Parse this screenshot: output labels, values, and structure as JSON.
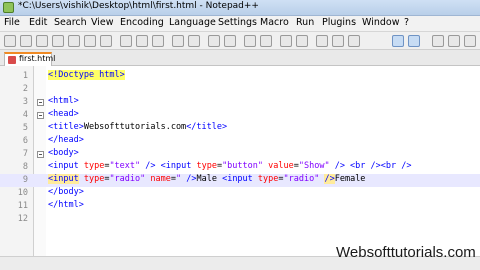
{
  "window": {
    "title": "*C:\\Users\\vishik\\Desktop\\html\\first.html - Notepad++"
  },
  "menu": [
    "File",
    "Edit",
    "Search",
    "View",
    "Encoding",
    "Language",
    "Settings",
    "Macro",
    "Run",
    "Plugins",
    "Window",
    "?"
  ],
  "toolbar": {
    "icons": [
      "new-file-icon",
      "open-file-icon",
      "save-icon",
      "save-all-icon",
      "close-icon",
      "close-all-icon",
      "print-icon",
      "cut-icon",
      "copy-icon",
      "paste-icon",
      "undo-icon",
      "redo-icon",
      "find-icon",
      "replace-icon",
      "zoom-in-icon",
      "zoom-out-icon",
      "sync-v-icon",
      "sync-h-icon",
      "wrap-icon",
      "all-chars-icon",
      "indent-guide-icon",
      "user-lang-icon",
      "doc-map-icon",
      "record-macro-icon",
      "stop-record-icon",
      "play-macro-icon"
    ]
  },
  "tab": {
    "label": "first.html"
  },
  "editor": {
    "line_numbers": [
      "1",
      "2",
      "3",
      "4",
      "5",
      "6",
      "7",
      "8",
      "9",
      "10",
      "11",
      "12"
    ],
    "line1": {
      "a": "<!Doctype html>"
    },
    "line3": {
      "a": "<html>"
    },
    "line4": {
      "a": "<head>"
    },
    "line5": {
      "a": "<title>",
      "b": "Websofttutorials.com",
      "c": "</title>"
    },
    "line6": {
      "a": "</head>"
    },
    "line7": {
      "a": "<body>"
    },
    "line8": {
      "a": "<input",
      "b": " type",
      "c": "=",
      "d": "\"text\"",
      "e": " />",
      "f": " <input",
      "g": " type",
      "h": "=",
      "i": "\"button\"",
      "j": " value",
      "k": "=",
      "l": "\"Show\"",
      "m": " />",
      "n": " <br />",
      "o": "<br />"
    },
    "line9": {
      "a": "<input",
      "b": " type",
      "c": "=",
      "d": "\"radio\"",
      "e": " name",
      "f": "=",
      "g": "\" ",
      "h": "/>",
      "i": "Male ",
      "j": "<input",
      "k": " type",
      "l": "=",
      "m": "\"radio\"",
      "n": " ",
      "o": "/>",
      "p": "Female"
    },
    "line10": {
      "a": "</body>"
    },
    "line11": {
      "a": "</html>"
    }
  },
  "watermark": "Websofttutorials.com"
}
